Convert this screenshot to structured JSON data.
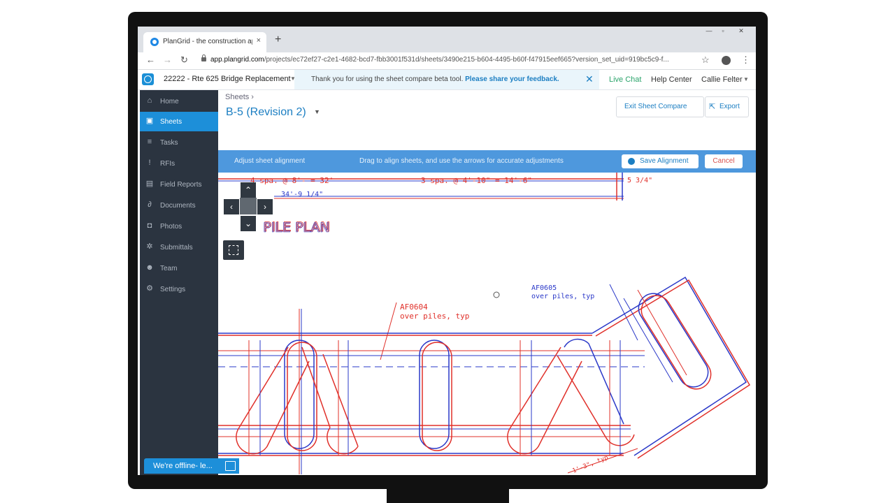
{
  "browser": {
    "tab_title": "PlanGrid - the construction app",
    "tab_close": "×",
    "new_tab": "+",
    "url_host": "app.plangrid.com",
    "url_path": "/projects/ec72ef27-c2e1-4682-bcd7-fbb3001f531d/sheets/3490e215-b604-4495-b60f-f47915eef665?version_set_uid=919bc5c9-f...",
    "back": "←",
    "forward": "→",
    "reload": "↻",
    "star": "☆",
    "menu": "⋮"
  },
  "header": {
    "project": "22222 - Rte 625 Bridge Replacement",
    "banner_text": "Thank you for using the sheet compare beta tool.",
    "banner_link": "Please share your feedback.",
    "banner_close": "✕",
    "live_chat": "Live Chat",
    "help_center": "Help Center",
    "user": "Callie Felter"
  },
  "sidebar": {
    "items": [
      {
        "label": "Home",
        "icon": "home-icon",
        "glyph": "⌂"
      },
      {
        "label": "Sheets",
        "icon": "sheets-icon",
        "glyph": "▣"
      },
      {
        "label": "Tasks",
        "icon": "tasks-icon",
        "glyph": "≡"
      },
      {
        "label": "RFIs",
        "icon": "rfi-icon",
        "glyph": "!"
      },
      {
        "label": "Field Reports",
        "icon": "field-reports-icon",
        "glyph": "▤"
      },
      {
        "label": "Documents",
        "icon": "paperclip-icon",
        "glyph": "∂"
      },
      {
        "label": "Photos",
        "icon": "camera-icon",
        "glyph": "◘"
      },
      {
        "label": "Submittals",
        "icon": "submittals-icon",
        "glyph": "✲"
      },
      {
        "label": "Team",
        "icon": "team-icon",
        "glyph": "☻"
      },
      {
        "label": "Settings",
        "icon": "gear-icon",
        "glyph": "⚙"
      }
    ],
    "offline_text": "We're offline- le..."
  },
  "main": {
    "breadcrumb": "Sheets ›",
    "sheet_title": "B-5 (Revision 2)",
    "exit_compare": "Exit Sheet Compare",
    "export": "Export",
    "align_title": "Adjust sheet alignment",
    "align_hint": "Drag to align sheets, and use the arrows for accurate adjustments",
    "save_alignment": "Save Alignment",
    "cancel": "Cancel"
  },
  "drawing": {
    "pile_plan": "PILE PLAN",
    "dim_1": "4 spa. @ 8'-  = 32'",
    "dim_2": "3 spa. @ 4'-10\" = 14'-6\"",
    "dim_3": "34'-9 1/4\"",
    "dim_4": "5 3/4\"",
    "note_1_code": "AF0604",
    "note_1_text": "over piles, typ",
    "note_2_code": "AF0605",
    "note_2_text": "over piles, typ",
    "dim_5": "1'-3\", typ"
  },
  "colors": {
    "accent": "#1d8fd9",
    "sidebar": "#2b3440",
    "overlay_red": "#e0302a",
    "overlay_blue": "#2a38c8"
  }
}
